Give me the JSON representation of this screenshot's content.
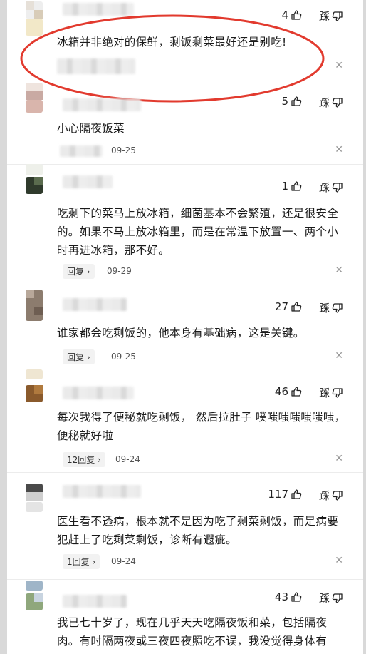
{
  "comments": [
    {
      "likes": "4",
      "dislike_label": "踩",
      "text": "冰箱并非绝对的保鲜，剩饭剩菜最好还是别吃!",
      "reply": "",
      "date": ""
    },
    {
      "likes": "5",
      "dislike_label": "踩",
      "text": "小心隔夜饭菜",
      "reply": "",
      "date": "09-25"
    },
    {
      "likes": "1",
      "dislike_label": "踩",
      "text": "吃剩下的菜马上放冰箱，细菌基本不会繁殖，还是很安全的。如果不马上放冰箱里，而是在常温下放置一、两个小时再进冰箱，那不好。",
      "reply": "回复 ›",
      "date": "09-29"
    },
    {
      "likes": "27",
      "dislike_label": "踩",
      "text": "谁家都会吃剩饭的，他本身有基础病，这是关键。",
      "reply": "回复 ›",
      "date": "09-25"
    },
    {
      "likes": "46",
      "dislike_label": "踩",
      "text": "每次我得了便秘就吃剩饭， 然后拉肚子 噗嗤嗤嗤嗤嗤嗤，便秘就好啦",
      "reply": "12回复 ›",
      "date": "09-24"
    },
    {
      "likes": "117",
      "dislike_label": "踩",
      "text": "医生看不透病，根本就不是因为吃了剩菜剩饭，而是病要犯赶上了吃剩菜剩饭，诊断有遐疵。",
      "reply": "1回复 ›",
      "date": "09-24"
    },
    {
      "likes": "43",
      "dislike_label": "踩",
      "text": "我已七十岁了，现在几乎天天吃隔夜饭和菜，包括隔夜肉。有时隔两夜或三夜四夜照吃不误，我没觉得身体有",
      "reply": "",
      "date": ""
    }
  ],
  "icons": {
    "like": "thumbs-up-icon",
    "dislike": "thumbs-down-icon",
    "close": "close-icon"
  },
  "colors": {
    "highlight": "#e23a2e"
  }
}
